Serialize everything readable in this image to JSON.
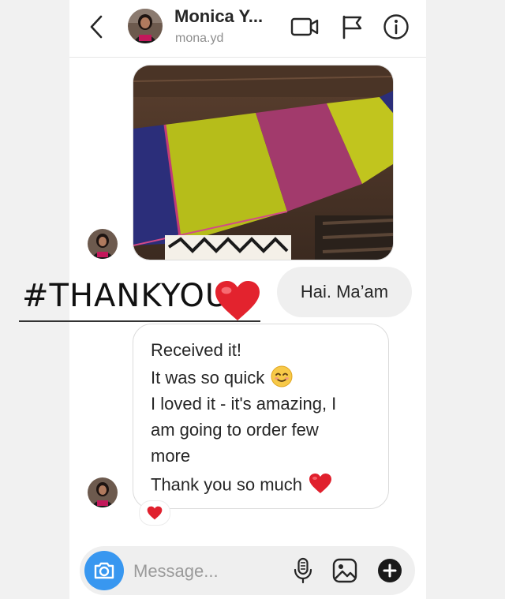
{
  "header": {
    "name": "Monica Y...",
    "username": "mona.yd"
  },
  "icons": {
    "back": "chevron-left-icon",
    "video": "video-camera-icon",
    "flag": "flag-icon",
    "info": "info-icon",
    "camera": "camera-icon",
    "mic": "microphone-icon",
    "gallery": "gallery-icon",
    "plus": "plus-circle-icon",
    "heart": "red-heart-emoji",
    "smile": "smiling-face-emoji"
  },
  "messages": {
    "sent": "Hai. Ma’am",
    "received_lines": [
      "Received it!",
      "It was so quick",
      "I loved it - it's amazing, I",
      "am going to order few",
      "more",
      "Thank you so much"
    ]
  },
  "overlay": {
    "hashtag": "#THANKYOU"
  },
  "composer": {
    "placeholder": "Message..."
  },
  "colors": {
    "accent": "#3897f0",
    "heart": "#e0202d",
    "bubble_sent": "#efefef",
    "border": "#dbdbdb"
  }
}
